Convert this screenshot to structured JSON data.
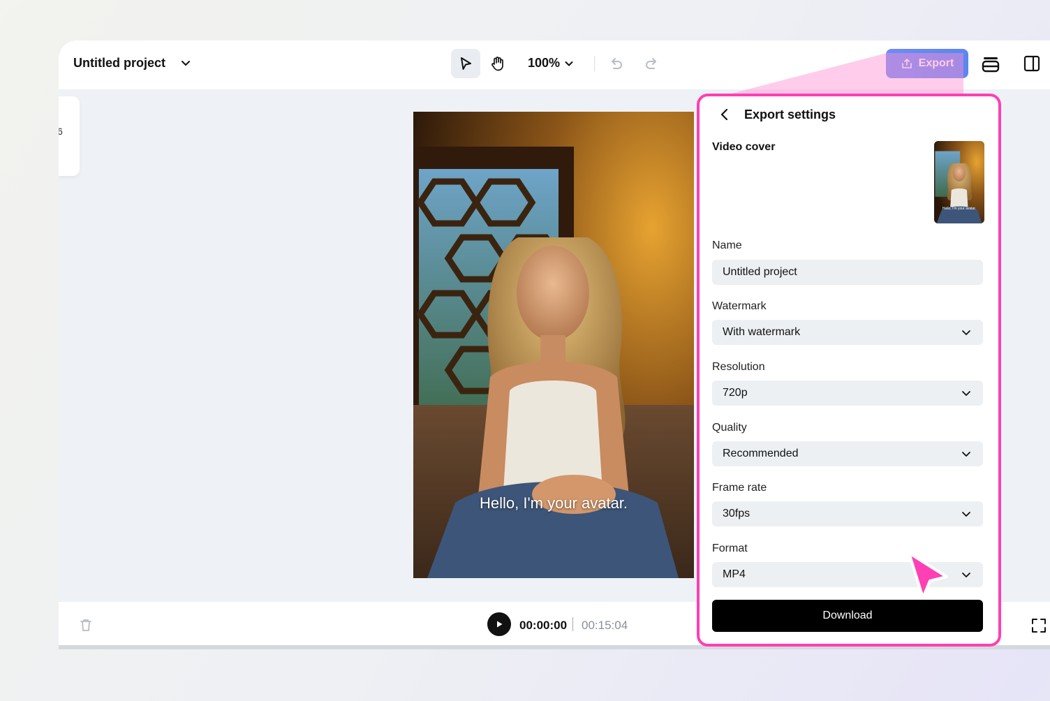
{
  "topbar": {
    "project_title": "Untitled project",
    "zoom": "100%",
    "export_label": "Export"
  },
  "left_card": {
    "number": "6"
  },
  "video": {
    "caption": "Hello, I'm your avatar."
  },
  "timeline": {
    "current_time": "00:00:00",
    "total_time": "00:15:04"
  },
  "export_settings": {
    "title": "Export settings",
    "cover_label": "Video cover",
    "cover_caption": "Hello, I'm your avatar.",
    "name_label": "Name",
    "name_value": "Untitled project",
    "watermark_label": "Watermark",
    "watermark_value": "With watermark",
    "resolution_label": "Resolution",
    "resolution_value": "720p",
    "quality_label": "Quality",
    "quality_value": "Recommended",
    "framerate_label": "Frame rate",
    "framerate_value": "30fps",
    "format_label": "Format",
    "format_value": "MP4",
    "download_label": "Download"
  },
  "colors": {
    "accent_pink": "#ff3fb4",
    "export_blue": "#5c86ef",
    "download_black": "#000000"
  },
  "icons": [
    "chevron-down-icon",
    "select-arrow-icon",
    "hand-icon",
    "undo-icon",
    "redo-icon",
    "upload-icon",
    "layers-icon",
    "side-panel-icon",
    "back-chevron-icon",
    "trash-icon",
    "play-icon",
    "fullscreen-icon",
    "pointer-cursor-icon"
  ]
}
